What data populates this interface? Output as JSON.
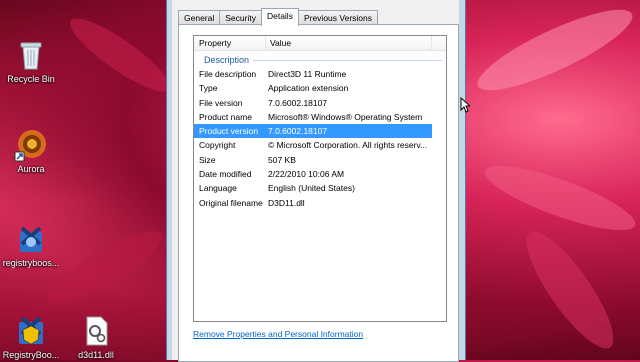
{
  "desktop": {
    "icons": [
      {
        "label": "Recycle Bin"
      },
      {
        "label": "Aurora"
      },
      {
        "label": "registryboos..."
      },
      {
        "label": "RegistryBoo..."
      },
      {
        "label": "d3d11.dll"
      }
    ]
  },
  "dialog": {
    "tabs": [
      "General",
      "Security",
      "Details",
      "Previous Versions"
    ],
    "active_tab": "Details",
    "columns": {
      "property": "Property",
      "value": "Value"
    },
    "group": "Description",
    "rows": [
      {
        "k": "File description",
        "v": "Direct3D 11 Runtime"
      },
      {
        "k": "Type",
        "v": "Application extension"
      },
      {
        "k": "File version",
        "v": "7.0.6002.18107"
      },
      {
        "k": "Product name",
        "v": "Microsoft® Windows® Operating System"
      },
      {
        "k": "Product version",
        "v": "7.0.6002.18107"
      },
      {
        "k": "Copyright",
        "v": "© Microsoft Corporation. All rights reserv..."
      },
      {
        "k": "Size",
        "v": "507 KB"
      },
      {
        "k": "Date modified",
        "v": "2/22/2010 10:06 AM"
      },
      {
        "k": "Language",
        "v": "English (United States)"
      },
      {
        "k": "Original filename",
        "v": "D3D11.dll"
      }
    ],
    "selected_row": "Product version",
    "remove_link": "Remove Properties and Personal Information"
  },
  "colors": {
    "selection": "#3399ff",
    "group_text": "#1e5aa8",
    "link": "#0066cc"
  }
}
